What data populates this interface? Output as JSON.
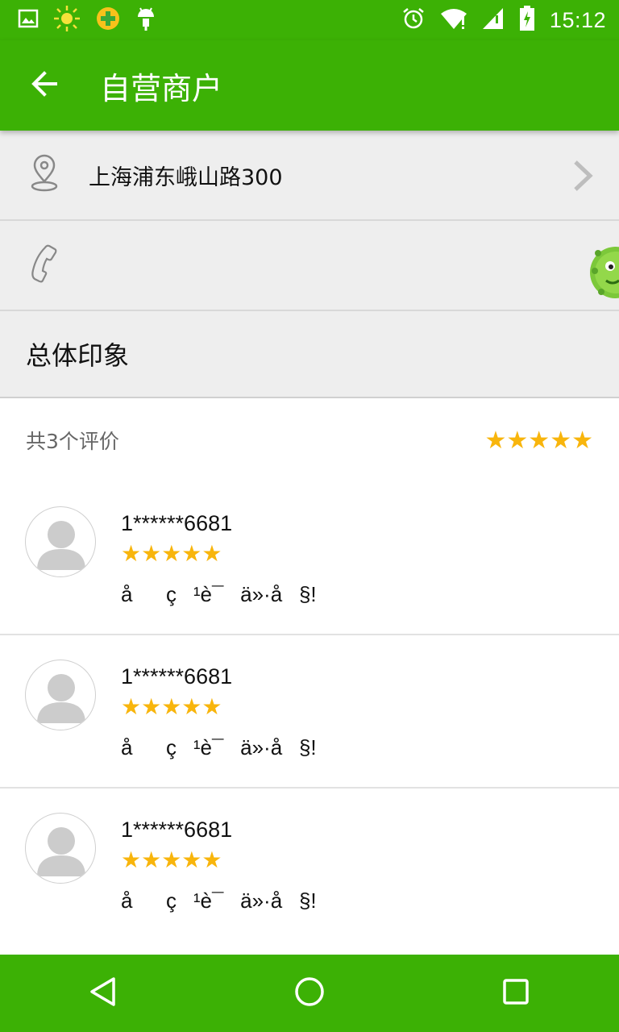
{
  "status_bar": {
    "time": "15:12",
    "left_icons": [
      "gallery-icon",
      "weather-sun-icon",
      "security-app-icon",
      "android-debug-icon"
    ],
    "right_icons": [
      "alarm-icon",
      "wifi-icon",
      "cell-signal-icon",
      "battery-charging-icon"
    ]
  },
  "app_bar": {
    "title": "自营商户",
    "back_icon": "arrow-back-icon"
  },
  "contact": {
    "address": "上海浦东峨山路300",
    "phone": ""
  },
  "section": {
    "title": "总体印象"
  },
  "summary": {
    "count_text": "共3个评价",
    "stars": "★★★★★",
    "rating": 5
  },
  "reviews": [
    {
      "user": "1******6681",
      "stars": "★★★★★",
      "rating": 5,
      "text": "åç¹è¯ä»·å§!"
    },
    {
      "user": "1******6681",
      "stars": "★★★★★",
      "rating": 5,
      "text": "åç¹è¯ä»·å§!"
    },
    {
      "user": "1******6681",
      "stars": "★★★★★",
      "rating": 5,
      "text": "åç¹è¯ä»·å§!"
    }
  ],
  "colors": {
    "brand_green": "#3cb105",
    "star_gold": "#f8b50c",
    "row_gray": "#eeeeee"
  }
}
